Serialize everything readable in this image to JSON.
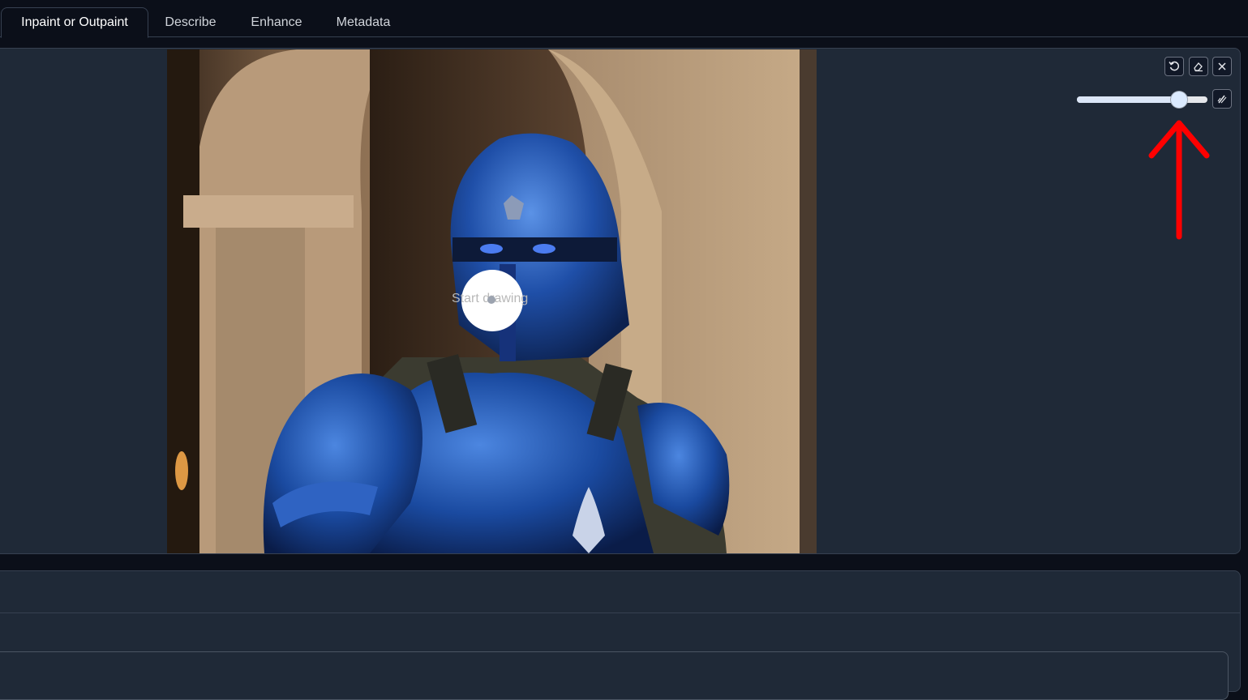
{
  "tabs": [
    {
      "label": "Inpaint or Outpaint",
      "active": true
    },
    {
      "label": "Describe",
      "active": false
    },
    {
      "label": "Enhance",
      "active": false
    },
    {
      "label": "Metadata",
      "active": false
    }
  ],
  "canvas": {
    "overlay_text": "Start drawing",
    "image_subject": "knight in blue plate armor in a stone archway"
  },
  "toolbar": {
    "undo_icon": "undo-icon",
    "eraser_icon": "eraser-icon",
    "close_icon": "close-icon",
    "brush_icon": "brush-color-icon"
  },
  "brush_size_slider": {
    "value_fraction": 0.78
  },
  "annotation": {
    "arrow_color": "#ff0000",
    "points_to": "brush size slider"
  },
  "colors": {
    "background": "#0b0f19",
    "panel": "#1f2937",
    "border": "#374151"
  }
}
